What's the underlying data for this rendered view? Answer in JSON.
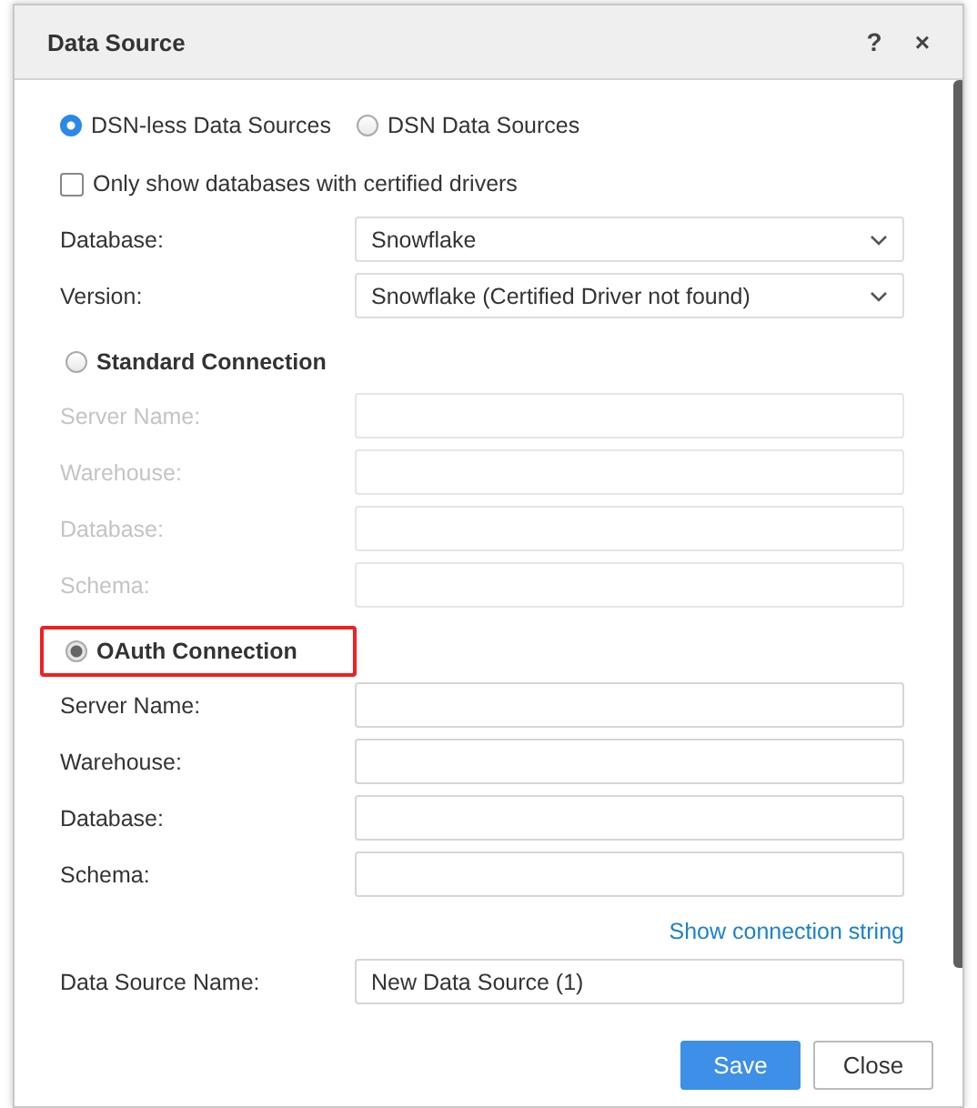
{
  "dialog": {
    "title": "Data Source",
    "help": "?",
    "close": "×"
  },
  "source_types": [
    {
      "label": "DSN-less Data Sources",
      "selected": true
    },
    {
      "label": "DSN Data Sources",
      "selected": false
    }
  ],
  "certified_only": {
    "label": "Only show databases with certified drivers",
    "checked": false
  },
  "selects": [
    {
      "label": "Database:",
      "value": "Snowflake"
    },
    {
      "label": "Version:",
      "value": "Snowflake (Certified Driver not found)"
    }
  ],
  "connections": [
    {
      "label": "Standard Connection",
      "selected": false,
      "highlighted": false,
      "fields": [
        {
          "label": "Server Name:"
        },
        {
          "label": "Warehouse:"
        },
        {
          "label": "Database:"
        },
        {
          "label": "Schema:"
        }
      ]
    },
    {
      "label": "OAuth Connection",
      "selected": true,
      "highlighted": true,
      "fields": [
        {
          "label": "Server Name:"
        },
        {
          "label": "Warehouse:"
        },
        {
          "label": "Database:"
        },
        {
          "label": "Schema:"
        }
      ]
    }
  ],
  "connection_string_link": "Show connection string",
  "name_field": {
    "label": "Data Source Name:",
    "value": "New Data Source (1)"
  },
  "buttons": [
    {
      "label": "Save",
      "kind": "primary"
    },
    {
      "label": "Close",
      "kind": "secondary"
    }
  ]
}
